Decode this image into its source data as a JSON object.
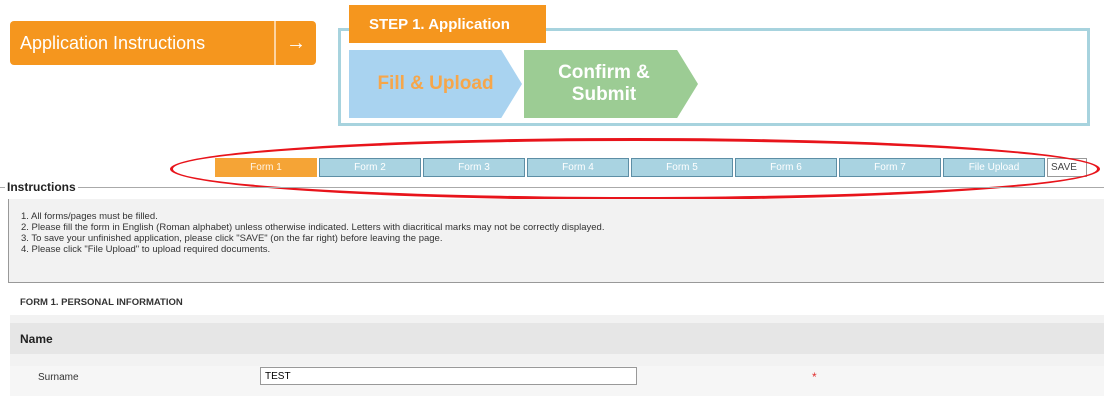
{
  "app_instructions": {
    "label": "Application Instructions",
    "arrow": "→"
  },
  "step": {
    "tag": "STEP 1. Application",
    "chevrons": [
      {
        "label": "Fill & Upload"
      },
      {
        "label": "Confirm & Submit"
      }
    ]
  },
  "tabs": {
    "items": [
      "Form 1",
      "Form 2",
      "Form 3",
      "Form 4",
      "Form 5",
      "Form 6",
      "Form 7",
      "File Upload"
    ],
    "active": "Form 1",
    "save_label": "SAVE"
  },
  "instructions": {
    "title": "Instructions",
    "items": [
      "1. All forms/pages must be filled.",
      "2. Please fill the form in English (Roman alphabet) unless otherwise indicated. Letters with diacritical marks may not be correctly displayed.",
      "3. To save your unfinished application, please click \"SAVE\" (on the far right) before leaving the page.",
      "4. Please click \"File Upload\" to upload required documents."
    ]
  },
  "form": {
    "title": "FORM 1. PERSONAL INFORMATION",
    "section": "Name",
    "fields": [
      {
        "label": "Surname",
        "value": "TEST",
        "required_mark": "*"
      }
    ]
  },
  "colors": {
    "orange": "#f5961e",
    "light_blue": "#a9d3e1",
    "green": "#9ccc94",
    "annotation_red": "#e8141b"
  }
}
